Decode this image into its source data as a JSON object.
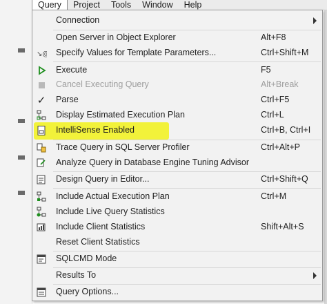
{
  "menubar": {
    "items": [
      "Query",
      "Project",
      "Tools",
      "Window",
      "Help"
    ]
  },
  "menu": {
    "items": [
      {
        "label": "Connection",
        "shortcut": "",
        "icon": "none",
        "submenu": true
      },
      {
        "label": "Open Server in Object Explorer",
        "shortcut": "Alt+F8",
        "icon": "none"
      },
      {
        "label": "Specify Values for Template Parameters...",
        "shortcut": "Ctrl+Shift+M",
        "icon": "template-params-icon"
      },
      {
        "label": "Execute",
        "shortcut": "F5",
        "icon": "play-icon"
      },
      {
        "label": "Cancel Executing Query",
        "shortcut": "Alt+Break",
        "icon": "stop-icon",
        "disabled": true
      },
      {
        "label": "Parse",
        "shortcut": "Ctrl+F5",
        "icon": "checkmark-icon"
      },
      {
        "label": "Display Estimated Execution Plan",
        "shortcut": "Ctrl+L",
        "icon": "execution-plan-icon"
      },
      {
        "label": "IntelliSense Enabled",
        "shortcut": "Ctrl+B, Ctrl+I",
        "icon": "intellisense-icon",
        "highlighted": true
      },
      {
        "label": "Trace Query in SQL Server Profiler",
        "shortcut": "Ctrl+Alt+P",
        "icon": "profiler-icon"
      },
      {
        "label": "Analyze Query in Database Engine Tuning Advisor",
        "shortcut": "",
        "icon": "tuning-advisor-icon"
      },
      {
        "label": "Design Query in Editor...",
        "shortcut": "Ctrl+Shift+Q",
        "icon": "design-query-icon"
      },
      {
        "label": "Include Actual Execution Plan",
        "shortcut": "Ctrl+M",
        "icon": "actual-plan-icon"
      },
      {
        "label": "Include Live Query Statistics",
        "shortcut": "",
        "icon": "live-stats-icon"
      },
      {
        "label": "Include Client Statistics",
        "shortcut": "Shift+Alt+S",
        "icon": "client-stats-icon"
      },
      {
        "label": "Reset Client Statistics",
        "shortcut": "",
        "icon": "none"
      },
      {
        "label": "SQLCMD Mode",
        "shortcut": "",
        "icon": "sqlcmd-icon"
      },
      {
        "label": "Results To",
        "shortcut": "",
        "icon": "none",
        "submenu": true
      },
      {
        "label": "Query Options...",
        "shortcut": "",
        "icon": "query-options-icon"
      }
    ]
  },
  "colors": {
    "highlight": "#f2f23a",
    "disabled_text": "#9d9d9d",
    "menu_bg": "#f2f2f2"
  }
}
